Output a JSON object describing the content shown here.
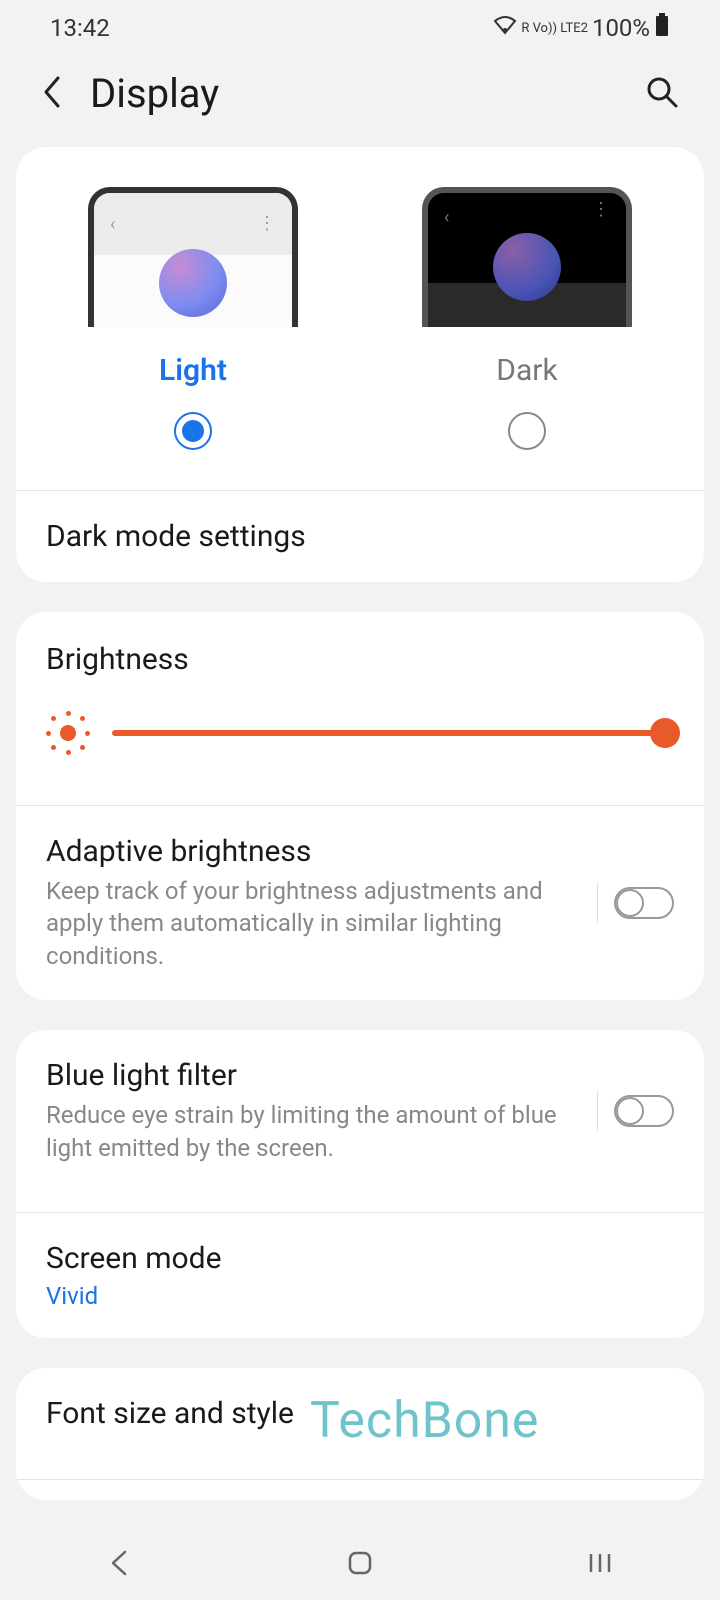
{
  "status": {
    "time": "13:42",
    "indicators": "R  Vo)) LTE2",
    "battery": "100%"
  },
  "header": {
    "title": "Display"
  },
  "theme": {
    "options": [
      {
        "label": "Light",
        "selected": true
      },
      {
        "label": "Dark",
        "selected": false
      }
    ],
    "dark_settings_label": "Dark mode settings"
  },
  "brightness": {
    "title": "Brightness",
    "value_percent": 100,
    "adaptive": {
      "title": "Adaptive brightness",
      "description": "Keep track of your brightness adjustments and apply them automatically in similar lighting conditions.",
      "enabled": false
    }
  },
  "blue_light": {
    "title": "Blue light filter",
    "description": "Reduce eye strain by limiting the amount of blue light emitted by the screen.",
    "enabled": false
  },
  "screen_mode": {
    "title": "Screen mode",
    "value": "Vivid"
  },
  "font": {
    "title": "Font size and style"
  },
  "watermark": "TechBone",
  "colors": {
    "accent_blue": "#1a73e8",
    "accent_orange": "#e85a2a"
  }
}
